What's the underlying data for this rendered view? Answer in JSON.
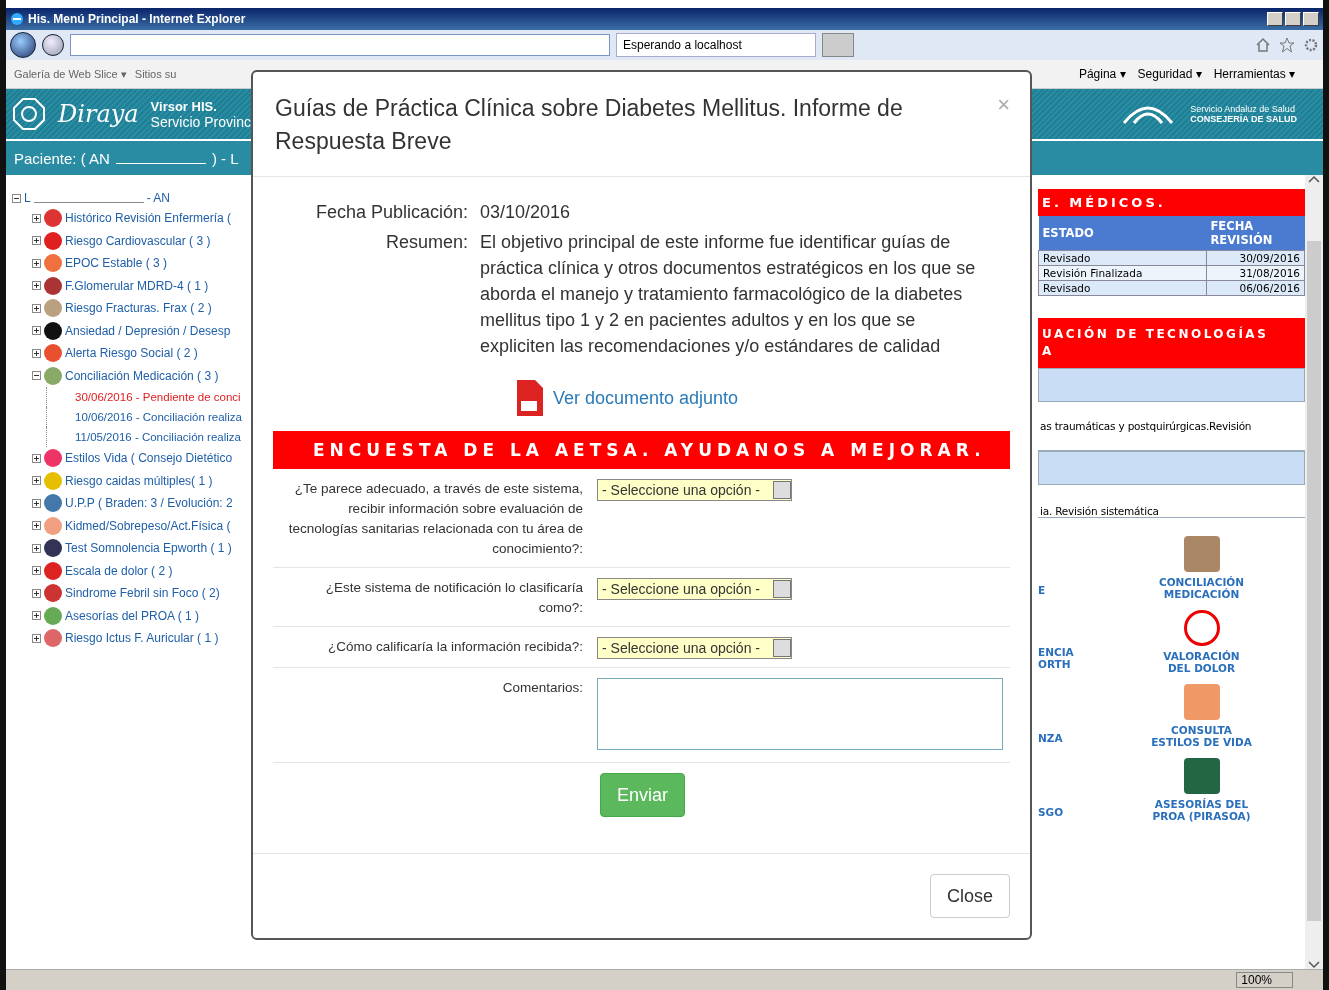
{
  "window": {
    "title": "His. Menú Principal - Internet Explorer"
  },
  "browser": {
    "tab_title": "Esperando a localhost",
    "favorites": [
      "Galería de Web Slice ▾",
      "Sitios su"
    ],
    "commands": [
      "Página ▾",
      "Seguridad ▾",
      "Herramientas ▾"
    ],
    "zoom": "100%"
  },
  "app_header": {
    "brand": "Diraya",
    "product": "Virsor HIS.",
    "subtitle": "Servicio Provinc",
    "agency_lines": [
      "Servicio Andaluz de Salud",
      "CONSEJERÍA DE SALUD"
    ]
  },
  "patient_bar": {
    "label": "Paciente: ( AN",
    "suffix": ") - L"
  },
  "tree": {
    "root": {
      "name": "L",
      "suffix": "- AN",
      "expanded": true
    },
    "items": [
      {
        "label": "Histórico Revisión Enfermería (",
        "expanded": false
      },
      {
        "label": "Riesgo Cardiovascular ( 3 )",
        "expanded": false
      },
      {
        "label": "EPOC Estable ( 3 )",
        "expanded": false
      },
      {
        "label": "F.Glomerular MDRD-4 ( 1 )",
        "expanded": false
      },
      {
        "label": "Riesgo Fracturas. Frax ( 2 )",
        "expanded": false
      },
      {
        "label": "Ansiedad / Depresión / Desesp",
        "expanded": false
      },
      {
        "label": "Alerta Riesgo Social ( 2 )",
        "expanded": false
      },
      {
        "label": "Conciliación Medicación ( 3 )",
        "expanded": true,
        "children": [
          {
            "label": "30/06/2016 - Pendiente de conci",
            "pending": true
          },
          {
            "label": "10/06/2016 - Conciliación realiza",
            "pending": false
          },
          {
            "label": "11/05/2016 - Conciliación realiza",
            "pending": false
          }
        ]
      },
      {
        "label": "Estilos Vida ( Consejo Dietético",
        "expanded": false
      },
      {
        "label": "Riesgo caidas múltiples( 1 )",
        "expanded": false
      },
      {
        "label": "U.P.P ( Braden: 3 / Evolución: 2",
        "expanded": false
      },
      {
        "label": "Kidmed/Sobrepeso/Act.Física (",
        "expanded": false
      },
      {
        "label": "Test Somnolencia Epworth ( 1 )",
        "expanded": false
      },
      {
        "label": "Escala de dolor ( 2 )",
        "expanded": false
      },
      {
        "label": "Sindrome Febril sin Foco ( 2)",
        "expanded": false
      },
      {
        "label": "Asesorías del PROA ( 1 )",
        "expanded": false
      },
      {
        "label": "Riesgo Ictus F. Auricular ( 1 )",
        "expanded": false
      }
    ]
  },
  "right_panel": {
    "section_1": {
      "title": "E. MÉDICOS.",
      "columns": [
        "ESTADO",
        "FECHA REVISIÓN"
      ],
      "rows": [
        [
          "Revisado",
          "30/09/2016"
        ],
        [
          "Revisión Finalizada",
          "31/08/2016"
        ],
        [
          "Revisado",
          "06/06/2016"
        ]
      ]
    },
    "section_2": {
      "title_lines": [
        "UACIÓN DE TECNOLOGÍAS",
        "A"
      ],
      "items": [
        "as traumáticas y postquirúrgicas.Revisión",
        "ia. Revisión sistemática"
      ]
    },
    "shortcuts": [
      {
        "left_lines": [
          "E"
        ],
        "right_lines": [
          "CONCILIACIÓN",
          "MEDICACIÓN"
        ]
      },
      {
        "left_lines": [
          "ENCIA",
          "ORTH"
        ],
        "right_lines": [
          "VALORACIÓN",
          "DEL DOLOR"
        ]
      },
      {
        "left_lines": [
          "NZA"
        ],
        "right_lines": [
          "CONSULTA",
          "ESTILOS DE VIDA"
        ]
      },
      {
        "left_lines": [
          "SGO"
        ],
        "right_lines": [
          "ASESORÍAS DEL",
          "PROA (PIRASOA)"
        ]
      }
    ]
  },
  "modal": {
    "title": "Guías de Práctica Clínica sobre Diabetes Mellitus. Informe de Respuesta Breve",
    "close_glyph": "×",
    "fields": [
      {
        "label": "Fecha Publicación:",
        "value": "03/10/2016"
      },
      {
        "label": "Resumen:",
        "value": "El objetivo principal de este informe fue identificar guías de práctica clínica y otros documentos estratégicos en los que se aborda el manejo y tratamiento farmacológico de la diabetes mellitus tipo 1 y 2 en pacientes adultos y en los que se expliciten las recomendaciones y/o estándares de calidad"
      }
    ],
    "attachment_link": "Ver documento adjunto",
    "survey_title": "ENCUESTA DE LA AETSA. AYUDANOS A MEJORAR.",
    "questions": [
      {
        "kind": "select",
        "label": "¿Te parece adecuado, a través de este sistema, recibir información sobre evaluación de tecnologías sanitarias relacionada con tu área de conocimiento?:",
        "value": "- Seleccione una opción -"
      },
      {
        "kind": "select",
        "label": "¿Este sistema de notificación lo clasificaría como?:",
        "value": "- Seleccione una opción -"
      },
      {
        "kind": "select",
        "label": "¿Cómo calificaría la información recibida?:",
        "value": "- Seleccione una opción -"
      },
      {
        "kind": "textarea",
        "label": "Comentarios:"
      }
    ],
    "submit": "Enviar",
    "close_button": "Close"
  }
}
